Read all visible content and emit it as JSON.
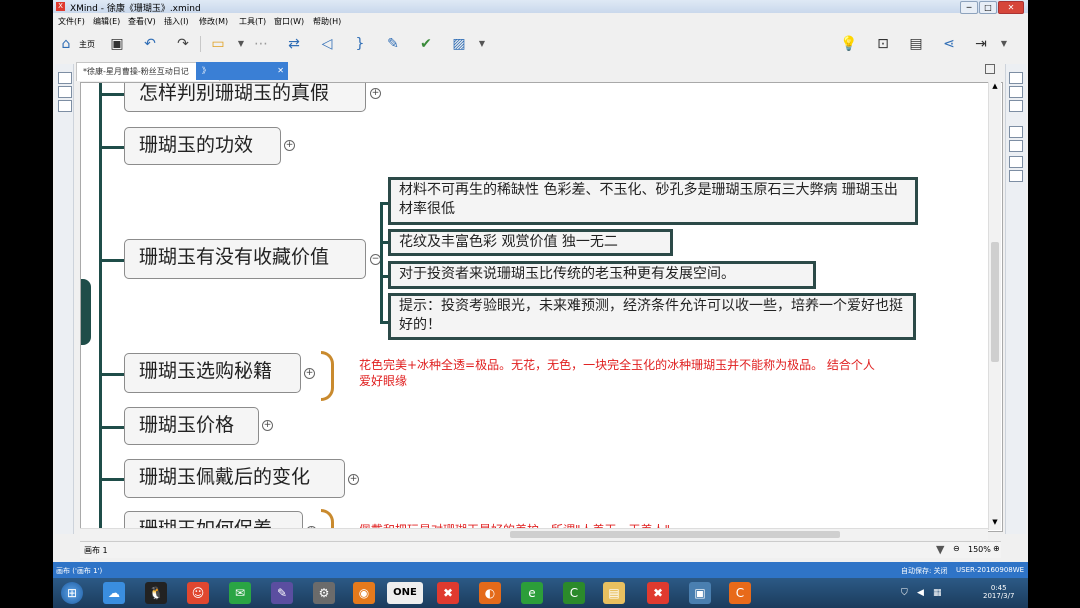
{
  "window": {
    "title": "XMind - 徐康《珊瑚玉》.xmind",
    "min": "─",
    "max": "□",
    "close": "✕"
  },
  "menu": [
    "文件(F)",
    "编辑(E)",
    "查看(V)",
    "插入(I)",
    "修改(M)",
    "工具(T)",
    "窗口(W)",
    "帮助(H)"
  ],
  "toolbar": {
    "home_label": "主页"
  },
  "tabs": [
    {
      "label": "*徐康-星月曹操-粉丝互动日记"
    },
    {
      "label": "》",
      "close": "✕"
    }
  ],
  "mindmap": {
    "topics": [
      "怎样判别珊瑚玉的真假",
      "珊瑚玉的功效",
      "珊瑚玉有没有收藏价值",
      "珊瑚玉选购秘籍",
      "珊瑚玉价格",
      "珊瑚玉佩戴后的变化",
      "珊瑚玉如何保养"
    ],
    "subtopics": [
      "材料不可再生的稀缺性 色彩差、不玉化、砂孔多是珊瑚玉原石三大弊病 珊瑚玉出材率很低",
      "花纹及丰富色彩 观赏价值 独一无二",
      "对于投资者来说珊瑚玉比传统的老玉种更有发展空间。",
      "提示：投资考验眼光，未来难预测，经济条件允许可以收一些，培养一个爱好也挺好的！"
    ],
    "notes": [
      "花色完美+冰种全透=极品。无花，无色，一块完全玉化的冰种珊瑚玉并不能称为极品。 结合个人爱好眼缘",
      "佩戴和把玩是对珊瑚玉最好的养护，所谓\"人养玉，玉养人\""
    ],
    "expand_symbol": "+"
  },
  "sheet": {
    "tab": "画布 1",
    "zoom": "150%"
  },
  "status": {
    "left": "画布 ('画布 1')",
    "autosave": "自动保存: 关闭",
    "user": "USER-20160908WE"
  },
  "taskbar": {
    "one_label": "ONE",
    "time": "0:45",
    "date": "2017/3/7"
  }
}
